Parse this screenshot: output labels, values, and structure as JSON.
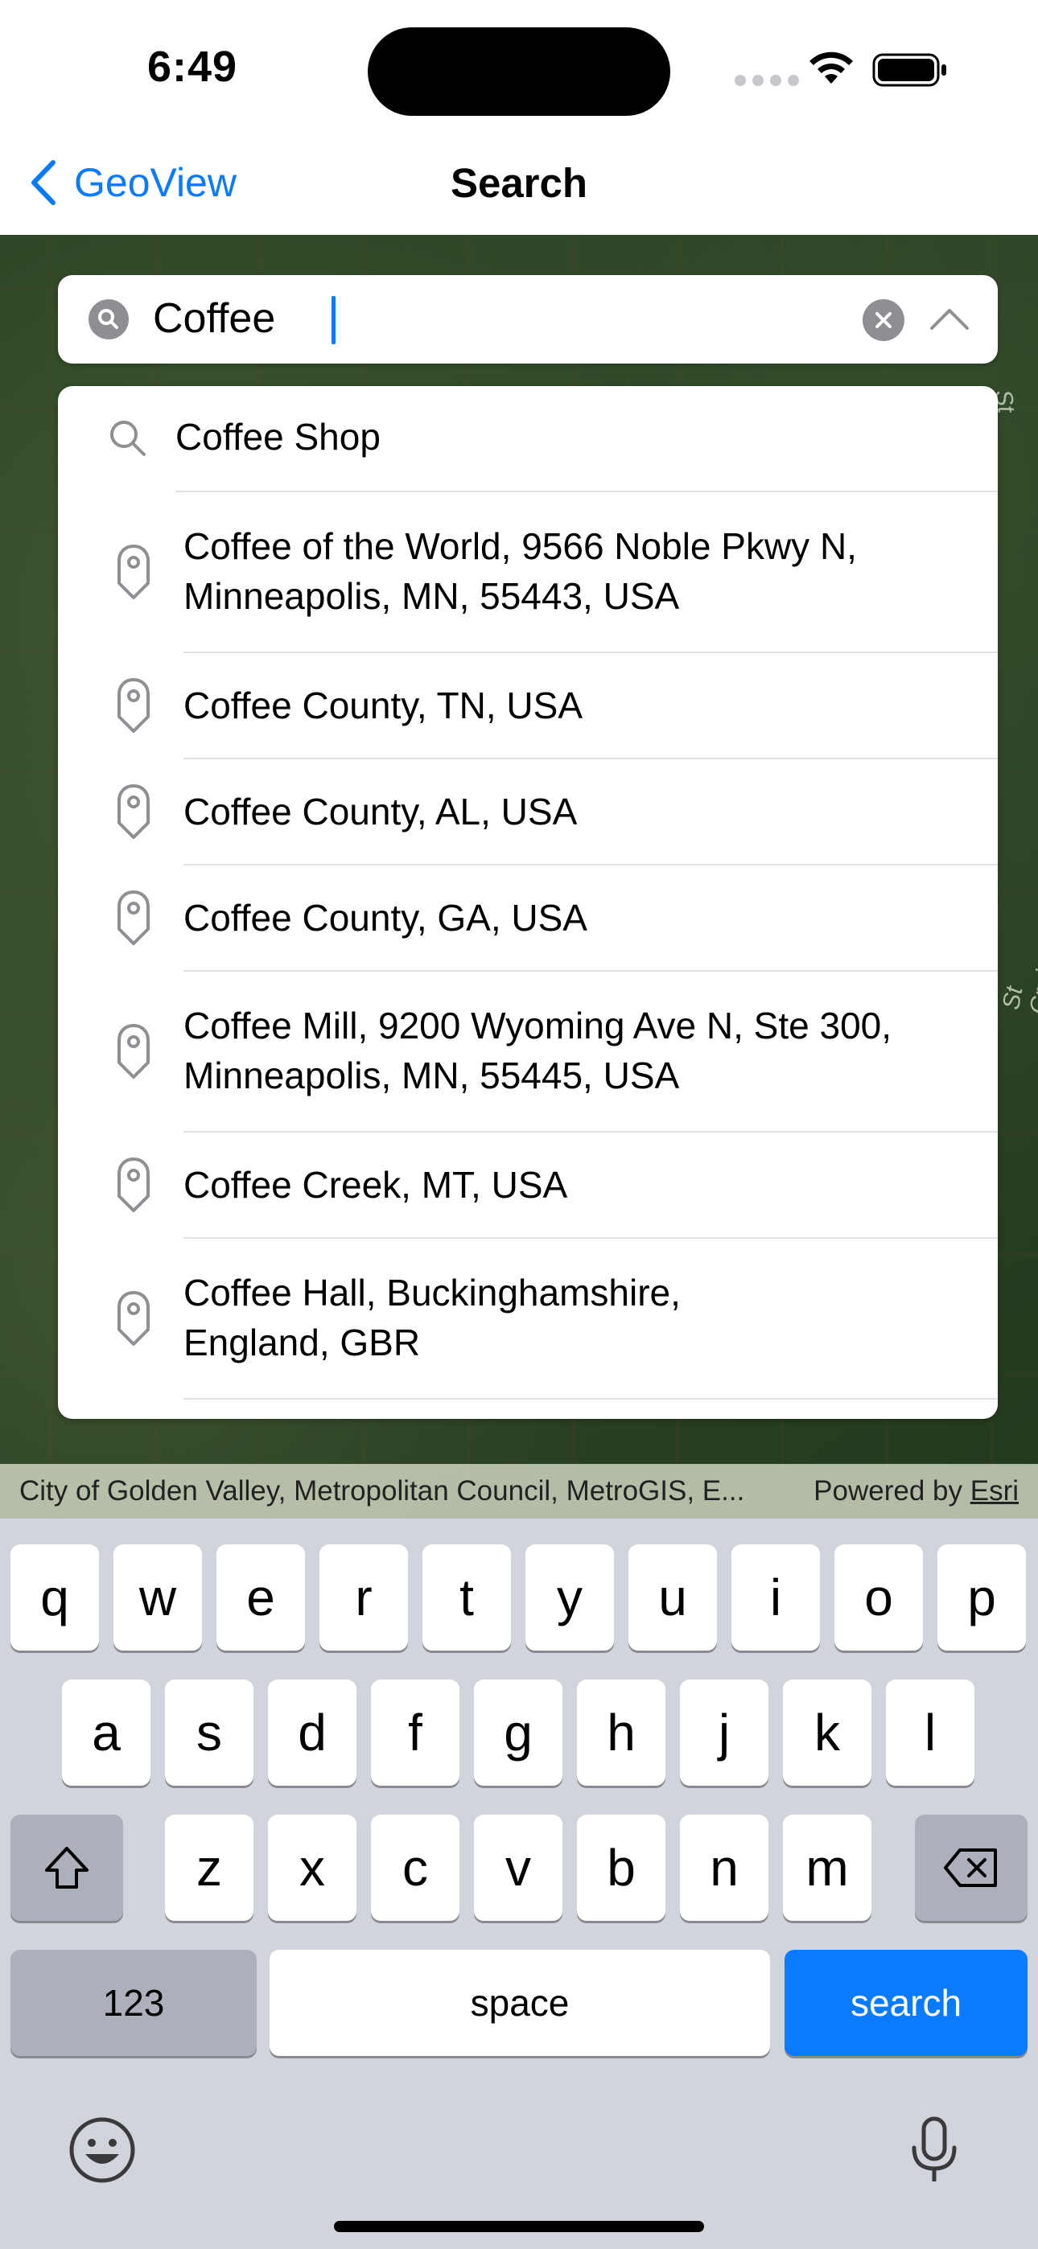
{
  "status_bar": {
    "time": "6:49"
  },
  "nav": {
    "back_label": "GeoView",
    "title": "Search"
  },
  "search": {
    "value": "Coffee",
    "placeholder": ""
  },
  "suggestion": {
    "label": "Coffee Shop"
  },
  "results": [
    {
      "line1": "Coffee of the World, 9566 Noble Pkwy N,",
      "line2": "Minneapolis, MN, 55443, USA"
    },
    {
      "line1": "Coffee County, TN, USA",
      "line2": ""
    },
    {
      "line1": "Coffee County, AL, USA",
      "line2": ""
    },
    {
      "line1": "Coffee County, GA, USA",
      "line2": ""
    },
    {
      "line1": "Coffee Mill, 9200 Wyoming Ave N, Ste 300,",
      "line2": "Minneapolis, MN, 55445, USA"
    },
    {
      "line1": "Coffee Creek, MT, USA",
      "line2": ""
    },
    {
      "line1": "Coffee Hall, Buckinghamshire,",
      "line2": "England, GBR"
    }
  ],
  "map": {
    "river_labels": [
      "St Croix River",
      "St Croix River"
    ]
  },
  "attribution": {
    "sources": "City of Golden Valley, Metropolitan Council, MetroGIS, E...",
    "powered_by": "Powered by",
    "esri": "Esri"
  },
  "keyboard": {
    "row1": [
      "q",
      "w",
      "e",
      "r",
      "t",
      "y",
      "u",
      "i",
      "o",
      "p"
    ],
    "row2": [
      "a",
      "s",
      "d",
      "f",
      "g",
      "h",
      "j",
      "k",
      "l"
    ],
    "row3": [
      "z",
      "x",
      "c",
      "v",
      "b",
      "n",
      "m"
    ],
    "numbers_label": "123",
    "space_label": "space",
    "search_label": "search"
  },
  "colors": {
    "accent": "#0a7aff",
    "keyboard_bg": "#d1d4da"
  }
}
